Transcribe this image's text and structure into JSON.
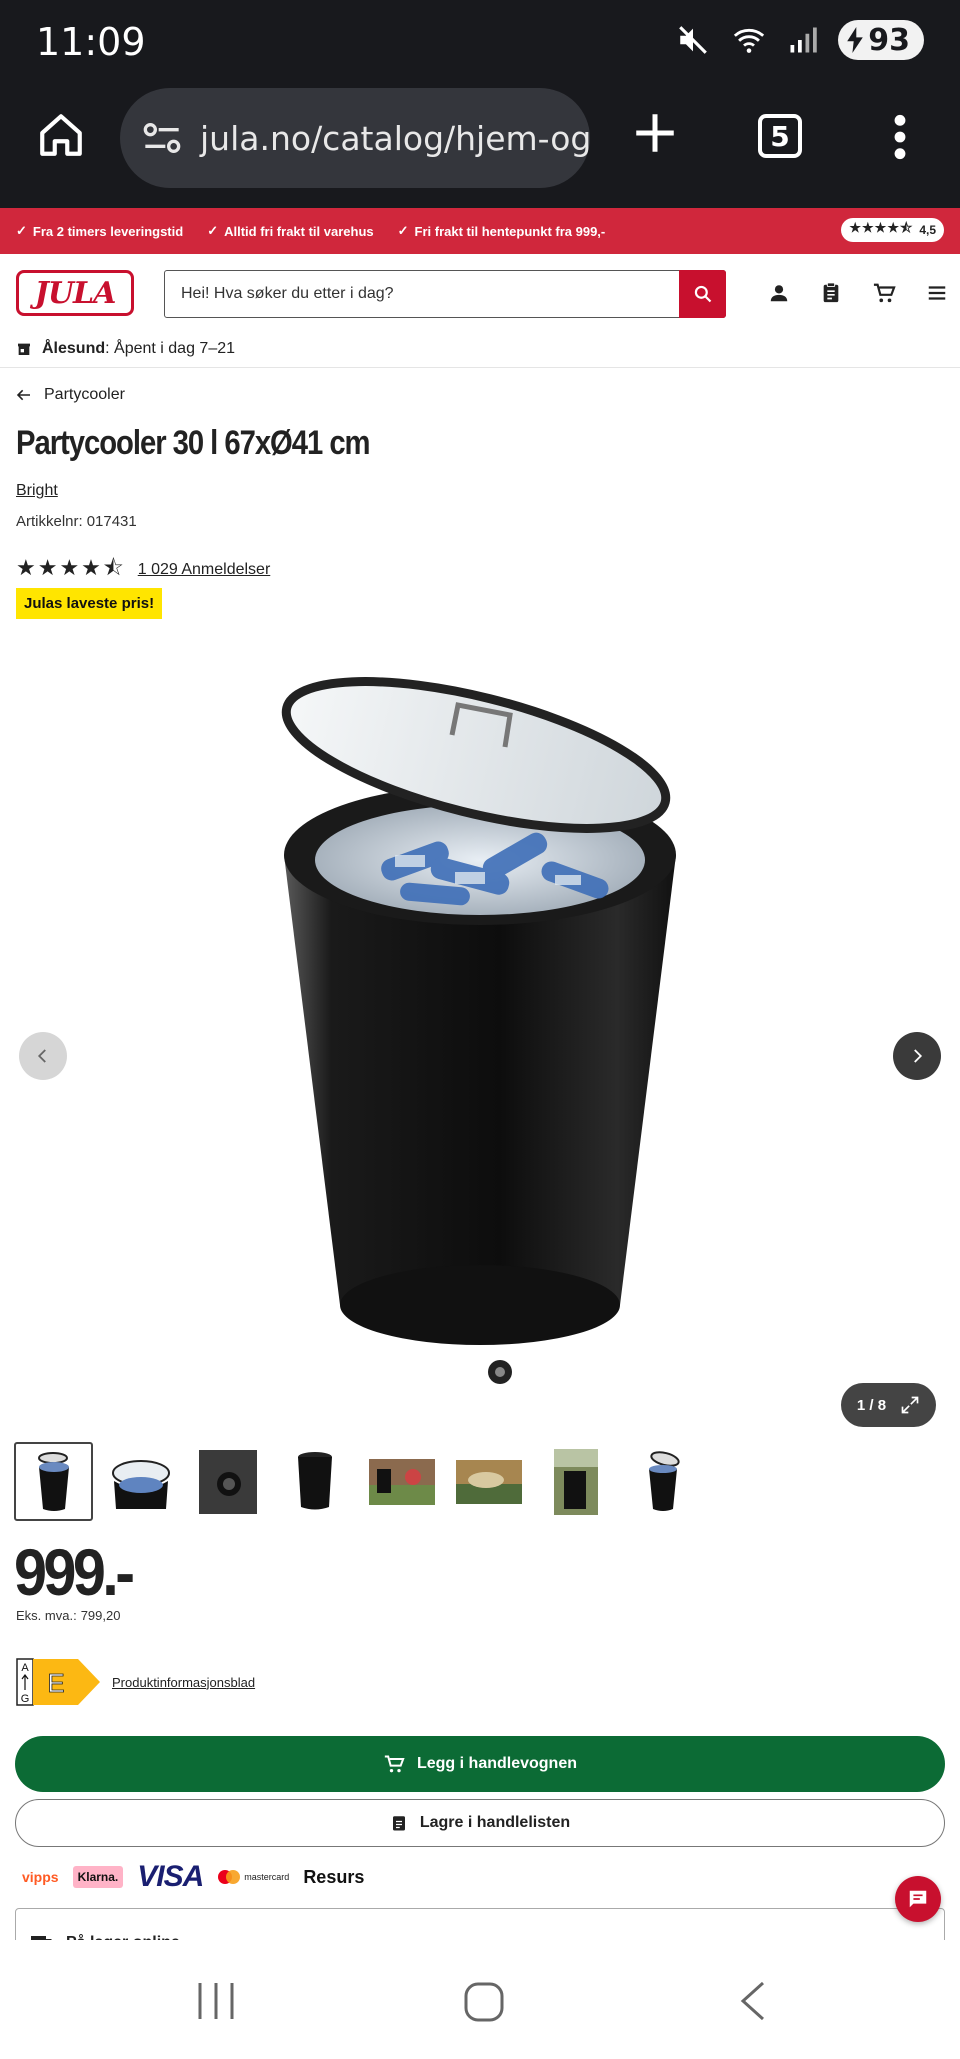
{
  "status_bar": {
    "time": "11:09",
    "battery": "93"
  },
  "browser": {
    "url": "jula.no/catalog/hjem-og-h",
    "tab_count": "5"
  },
  "promo": {
    "items": [
      "Fra 2 timers leveringstid",
      "Alltid fri frakt til varehus",
      "Fri frakt til hentepunkt fra 999,-"
    ],
    "rating": "4,5"
  },
  "header": {
    "logo_text": "JULA",
    "search_placeholder": "Hei! Hva søker du etter i dag?"
  },
  "store": {
    "name": "Ålesund",
    "hours": "Åpent i dag 7–21"
  },
  "product": {
    "breadcrumb_back": "Partycooler",
    "title": "Partycooler 30 l 67xØ41 cm",
    "brand": "Bright",
    "sku_label": "Artikkelnr:",
    "sku": "017431",
    "rating_value": 4.5,
    "reviews_link": "1 029 Anmeldelser",
    "badge": "Julas laveste pris!",
    "price": "999.-",
    "ex_vat_label": "Eks. mva.:",
    "ex_vat": "799,20",
    "energy_class": "E",
    "energy_scale_top": "A",
    "energy_scale_bottom": "G",
    "product_info_link": "Produktinformasjonsblad",
    "add_to_cart": "Legg i handlevognen",
    "save_to_list": "Lagre i handlelisten",
    "stock_status": "På lager online"
  },
  "gallery": {
    "counter": "1 / 8",
    "thumbnail_count": 8
  },
  "payments": [
    "vipps",
    "Klarna.",
    "VISA",
    "mastercard",
    "Resurs"
  ],
  "colors": {
    "brand_red": "#c8102e",
    "promo_red": "#d0273c",
    "cta_green": "#0c6b35",
    "badge_yellow": "#ffe500"
  }
}
